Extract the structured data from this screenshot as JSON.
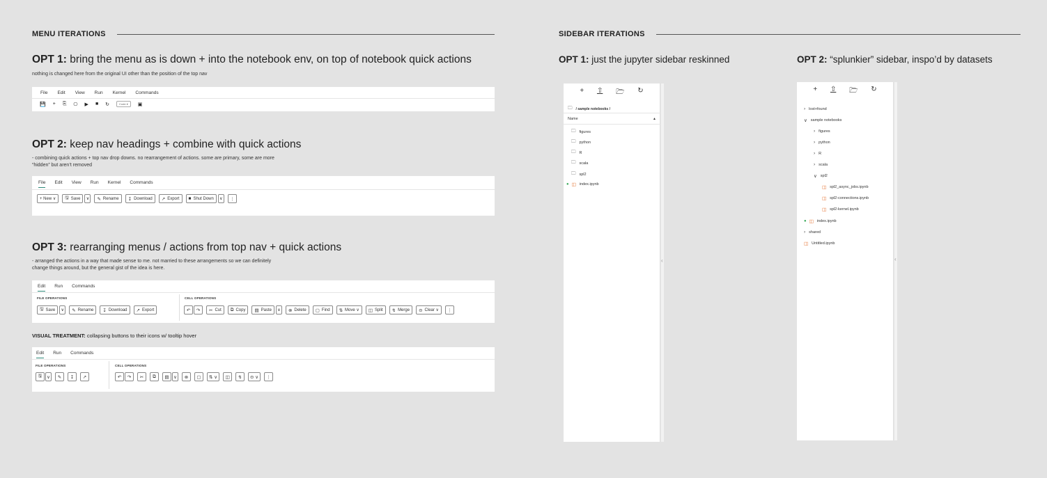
{
  "menu": {
    "heading": "MENU ITERATIONS",
    "opt1": {
      "title_bold": "OPT 1:",
      "title_rest": " bring the menu as is down + into the notebook env, on top of notebook quick actions",
      "desc": "nothing is changed here from the original UI other than the position of the top nav",
      "menu_items": [
        "File",
        "Edit",
        "View",
        "Run",
        "Kernel",
        "Commands"
      ],
      "quick_icons": [
        "💾",
        "+",
        "⎘",
        "⎘",
        "▶",
        "■",
        "↻"
      ],
      "code_label": "Code ▾",
      "last_icon": "▣"
    },
    "opt2": {
      "title_bold": "OPT 2:",
      "title_rest": " keep nav headings + combine with quick actions",
      "desc1": "- combining quick actions + top nav drop downs. no rearrangement of actions. some are primary, some are more",
      "desc2": "“hidden” but aren’t removed",
      "tabs": [
        "File",
        "Edit",
        "View",
        "Run",
        "Kernel",
        "Commands"
      ],
      "new_label": "+ New ∨",
      "save_label": "Save",
      "rename_label": "Rename",
      "download_label": "Download",
      "export_label": "Export",
      "shutdown_label": "Shut Down"
    },
    "opt3": {
      "title_bold": "OPT 3:",
      "title_rest": " rearranging menus / actions from top nav + quick actions",
      "desc1": "- arranged the actions in a way that made sense to me. not married to these arrangements so we can definitely",
      "desc2": "change  things around, but the general gist of the idea is here.",
      "tabs": [
        "Edit",
        "Run",
        "Commands"
      ],
      "file_ops": "FILE OPERATIONS",
      "cell_ops": "CELL OPERATIONS",
      "save_label": "Save",
      "rename_label": "Rename",
      "download_label": "Download",
      "export_label": "Export",
      "cut_label": "Cut",
      "copy_label": "Copy",
      "paste_label": "Paste",
      "delete_label": "Delete",
      "find_label": "Find",
      "move_label": "Move ∨",
      "split_label": "Split",
      "merge_label": "Merge",
      "clear_label": "Clear ∨"
    },
    "visual": {
      "title_bold": "VISUAL TREATMENT:",
      "title_rest": " collapsing buttons to their icons w/ tooltip hover",
      "tabs": [
        "Edit",
        "Run",
        "Commands"
      ],
      "file_ops": "FILE OPERATIONS",
      "cell_ops": "CELL OPERATIONS"
    }
  },
  "sidebar": {
    "heading": "SIDEBAR  ITERATIONS",
    "opt1": {
      "title_bold": "OPT 1:",
      "title_rest": " just the jupyter sidebar reskinned",
      "breadcrumb": "/  sample notebooks  /",
      "col_name": "Name",
      "items": [
        "figures",
        "python",
        "R",
        "scala",
        "spl2",
        "index.ipynb"
      ]
    },
    "opt2": {
      "title_bold": "OPT 2:",
      "title_rest": " “splunkier” sidebar, inspo’d by datasets",
      "items": [
        "lost+found",
        "sample notebooks",
        "figures",
        "python",
        "R",
        "scala",
        "spl2",
        "spl2_async_jobs.ipynb",
        "spl2-connections.ipynb",
        "spl2-kernel.ipynb",
        "index.ipynb",
        "shared",
        "Untitled.ipynb"
      ]
    }
  }
}
